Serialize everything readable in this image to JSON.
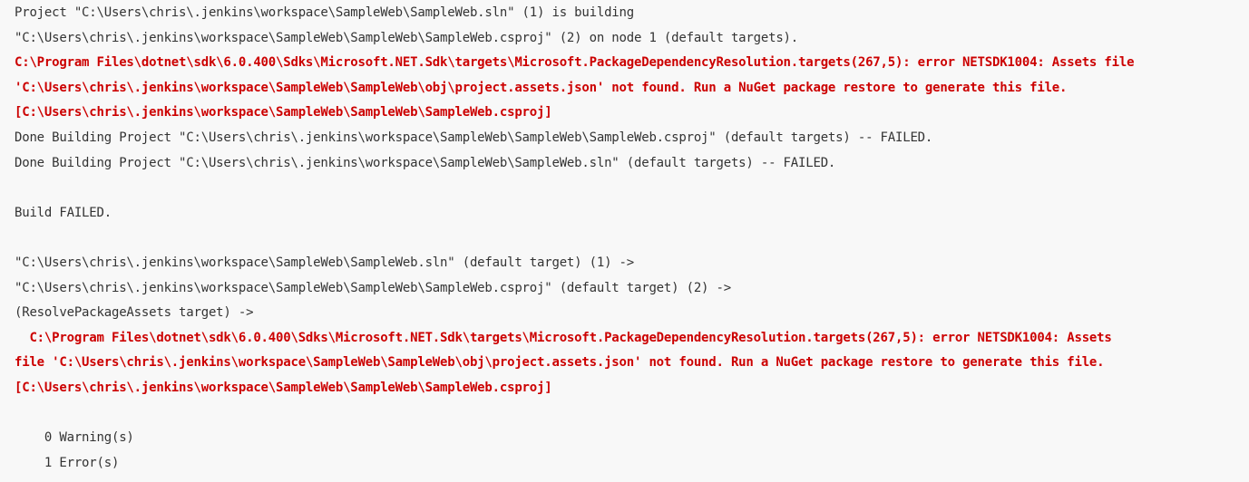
{
  "colors": {
    "background": "#f8f8f8",
    "text": "#333333",
    "error": "#cc0000"
  },
  "console": {
    "lines": [
      {
        "text": "Project \"C:\\Users\\chris\\.jenkins\\workspace\\SampleWeb\\SampleWeb.sln\" (1) is building",
        "kind": "normal"
      },
      {
        "text": "\"C:\\Users\\chris\\.jenkins\\workspace\\SampleWeb\\SampleWeb\\SampleWeb.csproj\" (2) on node 1 (default targets).",
        "kind": "normal"
      },
      {
        "text": "C:\\Program Files\\dotnet\\sdk\\6.0.400\\Sdks\\Microsoft.NET.Sdk\\targets\\Microsoft.PackageDependencyResolution.targets(267,5): error NETSDK1004: Assets file",
        "kind": "error"
      },
      {
        "text": "'C:\\Users\\chris\\.jenkins\\workspace\\SampleWeb\\SampleWeb\\obj\\project.assets.json' not found. Run a NuGet package restore to generate this file.",
        "kind": "error"
      },
      {
        "text": "[C:\\Users\\chris\\.jenkins\\workspace\\SampleWeb\\SampleWeb\\SampleWeb.csproj]",
        "kind": "error"
      },
      {
        "text": "Done Building Project \"C:\\Users\\chris\\.jenkins\\workspace\\SampleWeb\\SampleWeb\\SampleWeb.csproj\" (default targets) -- FAILED.",
        "kind": "normal"
      },
      {
        "text": "Done Building Project \"C:\\Users\\chris\\.jenkins\\workspace\\SampleWeb\\SampleWeb.sln\" (default targets) -- FAILED.",
        "kind": "normal"
      },
      {
        "text": "",
        "kind": "blank"
      },
      {
        "text": "Build FAILED.",
        "kind": "normal"
      },
      {
        "text": "",
        "kind": "blank"
      },
      {
        "text": "\"C:\\Users\\chris\\.jenkins\\workspace\\SampleWeb\\SampleWeb.sln\" (default target) (1) ->",
        "kind": "normal"
      },
      {
        "text": "\"C:\\Users\\chris\\.jenkins\\workspace\\SampleWeb\\SampleWeb\\SampleWeb.csproj\" (default target) (2) ->",
        "kind": "normal"
      },
      {
        "text": "(ResolvePackageAssets target) ->",
        "kind": "normal"
      },
      {
        "text": "  C:\\Program Files\\dotnet\\sdk\\6.0.400\\Sdks\\Microsoft.NET.Sdk\\targets\\Microsoft.PackageDependencyResolution.targets(267,5): error NETSDK1004: Assets",
        "kind": "error"
      },
      {
        "text": "file 'C:\\Users\\chris\\.jenkins\\workspace\\SampleWeb\\SampleWeb\\obj\\project.assets.json' not found. Run a NuGet package restore to generate this file.",
        "kind": "error"
      },
      {
        "text": "[C:\\Users\\chris\\.jenkins\\workspace\\SampleWeb\\SampleWeb\\SampleWeb.csproj]",
        "kind": "error"
      },
      {
        "text": "",
        "kind": "blank"
      },
      {
        "text": "    0 Warning(s)",
        "kind": "normal"
      },
      {
        "text": "    1 Error(s)",
        "kind": "normal"
      }
    ]
  }
}
